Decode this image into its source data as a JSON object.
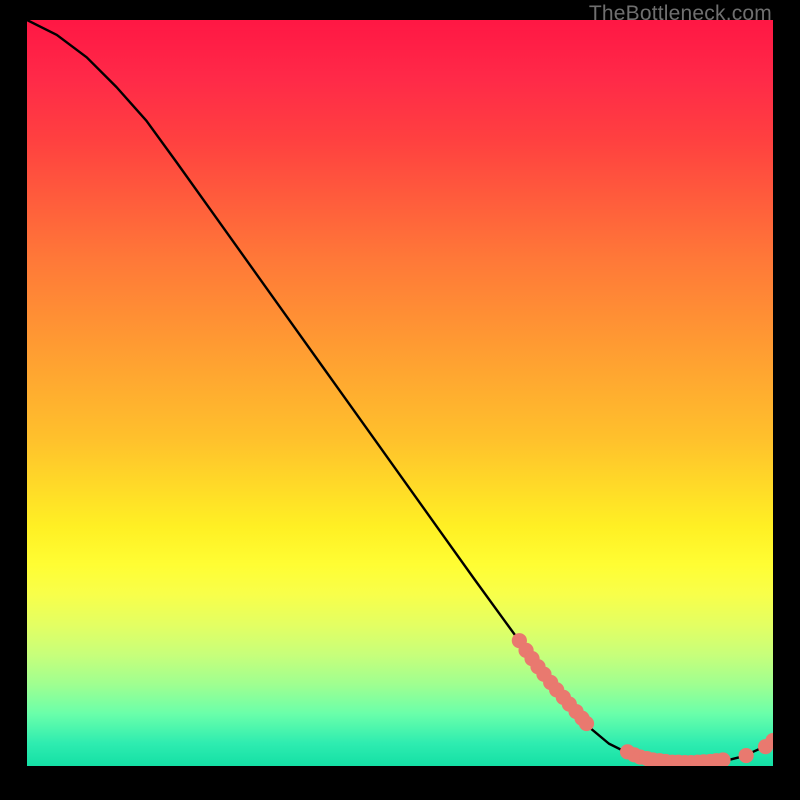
{
  "watermark": "TheBottleneck.com",
  "colors": {
    "line": "#000000",
    "dot_fill": "#e9796f",
    "dot_stroke": "#e9796f",
    "background": "#000000"
  },
  "chart_data": {
    "type": "line",
    "title": "",
    "xlabel": "",
    "ylabel": "",
    "xlim": [
      0,
      100
    ],
    "ylim": [
      0,
      100
    ],
    "series": [
      {
        "name": "bottleneck-curve",
        "x": [
          0,
          4,
          8,
          12,
          16,
          20,
          25,
          30,
          35,
          40,
          45,
          50,
          55,
          60,
          64,
          68,
          72,
          75,
          78,
          80,
          82,
          84,
          86,
          88,
          90,
          92,
          94,
          96,
          98,
          100
        ],
        "y": [
          100,
          98,
          95,
          91,
          86.5,
          81,
          74,
          67,
          60,
          53,
          46,
          39,
          32,
          25,
          19.5,
          14,
          9,
          5.5,
          3,
          2,
          1.3,
          0.8,
          0.5,
          0.4,
          0.4,
          0.5,
          0.8,
          1.3,
          2.2,
          3.4
        ]
      }
    ],
    "dot_clusters": [
      {
        "name": "upper-slope-cluster",
        "points": [
          {
            "x": 66.0,
            "y": 16.8
          },
          {
            "x": 66.9,
            "y": 15.5
          },
          {
            "x": 67.7,
            "y": 14.4
          },
          {
            "x": 68.5,
            "y": 13.3
          },
          {
            "x": 69.3,
            "y": 12.3
          },
          {
            "x": 70.2,
            "y": 11.2
          },
          {
            "x": 71.0,
            "y": 10.2
          },
          {
            "x": 71.9,
            "y": 9.2
          },
          {
            "x": 72.7,
            "y": 8.3
          },
          {
            "x": 73.6,
            "y": 7.3
          },
          {
            "x": 74.4,
            "y": 6.4
          },
          {
            "x": 75.0,
            "y": 5.7
          }
        ]
      },
      {
        "name": "valley-cluster",
        "points": [
          {
            "x": 80.5,
            "y": 1.9
          },
          {
            "x": 81.4,
            "y": 1.5
          },
          {
            "x": 82.2,
            "y": 1.2
          },
          {
            "x": 83.1,
            "y": 1.0
          },
          {
            "x": 83.9,
            "y": 0.8
          },
          {
            "x": 84.8,
            "y": 0.7
          },
          {
            "x": 85.6,
            "y": 0.6
          },
          {
            "x": 86.5,
            "y": 0.5
          },
          {
            "x": 87.3,
            "y": 0.5
          },
          {
            "x": 88.2,
            "y": 0.45
          },
          {
            "x": 89.0,
            "y": 0.45
          },
          {
            "x": 89.9,
            "y": 0.5
          },
          {
            "x": 90.7,
            "y": 0.55
          },
          {
            "x": 91.6,
            "y": 0.6
          },
          {
            "x": 92.4,
            "y": 0.7
          },
          {
            "x": 93.3,
            "y": 0.8
          },
          {
            "x": 96.4,
            "y": 1.4
          }
        ]
      },
      {
        "name": "right-tail-cluster",
        "points": [
          {
            "x": 99.0,
            "y": 2.6
          },
          {
            "x": 100.0,
            "y": 3.4
          }
        ]
      }
    ]
  }
}
